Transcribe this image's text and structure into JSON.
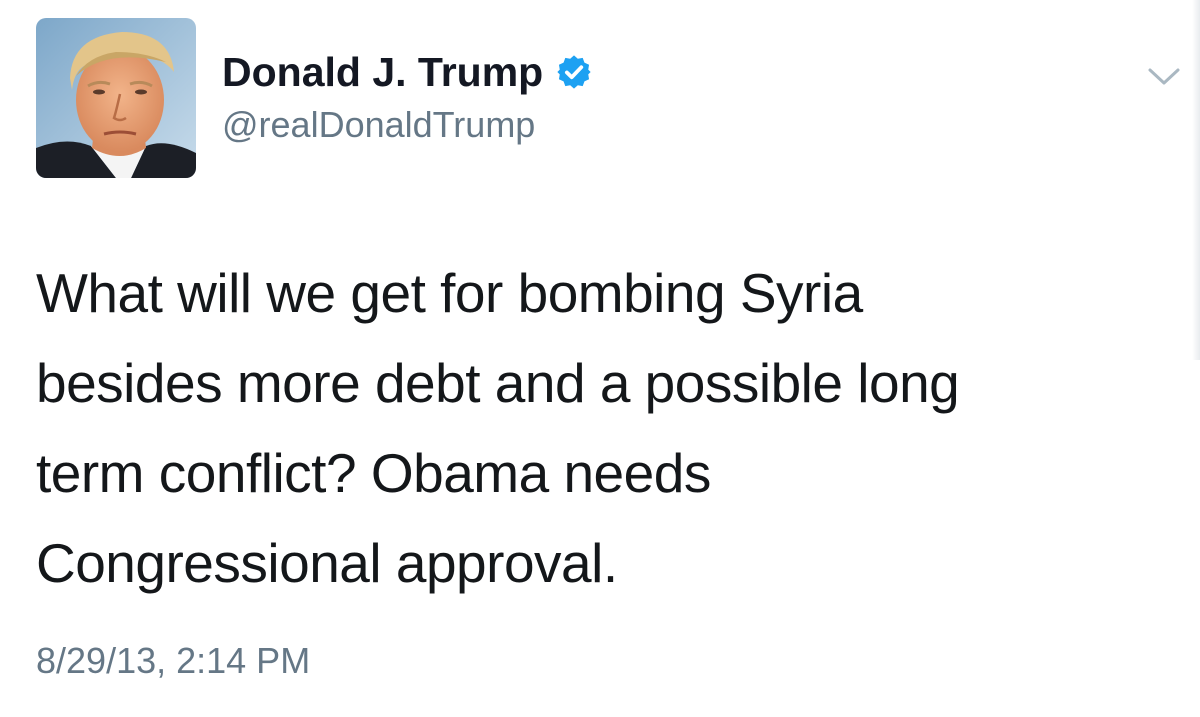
{
  "author": {
    "display_name": "Donald J. Trump",
    "handle": "@realDonaldTrump",
    "verified": true,
    "avatar_icon": "profile-photo",
    "verified_icon": "verified-badge-icon"
  },
  "tweet": {
    "text_lines": [
      "What will we get for bombing Syria",
      "besides more debt and a possible long",
      "term conflict? Obama needs",
      "Congressional approval."
    ],
    "timestamp": "8/29/13, 2:14 PM"
  },
  "menu": {
    "icon": "chevron-down-icon"
  },
  "colors": {
    "verified_blue": "#1DA1F2",
    "text_primary": "#14171a",
    "text_secondary": "#657786",
    "chevron": "#aab8c2"
  }
}
